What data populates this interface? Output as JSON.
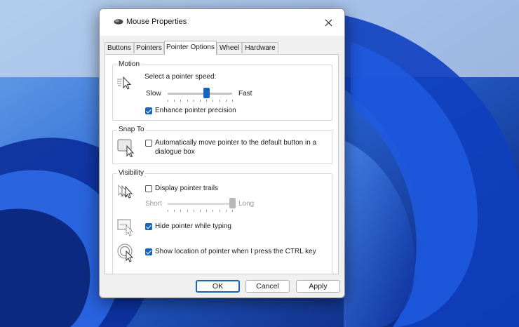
{
  "window": {
    "title": "Mouse Properties"
  },
  "tabs": [
    {
      "label": "Buttons"
    },
    {
      "label": "Pointers"
    },
    {
      "label": "Pointer Options"
    },
    {
      "label": "Wheel"
    },
    {
      "label": "Hardware"
    }
  ],
  "active_tab": "Pointer Options",
  "motion": {
    "group_label": "Motion",
    "speed_label": "Select a pointer speed:",
    "slow_label": "Slow",
    "fast_label": "Fast",
    "speed_value": 0.6,
    "enhance_label": "Enhance pointer precision",
    "enhance_checked": true
  },
  "snap": {
    "group_label": "Snap To",
    "auto_label_line1": "Automatically move pointer to the default button in a",
    "auto_label_line2": "dialogue box",
    "auto_checked": false
  },
  "visibility": {
    "group_label": "Visibility",
    "trails_label": "Display pointer trails",
    "trails_checked": false,
    "short_label": "Short",
    "long_label": "Long",
    "trails_value": 1.0,
    "hide_label": "Hide pointer while typing",
    "hide_checked": true,
    "ctrl_label": "Show location of pointer when I press the CTRL key",
    "ctrl_checked": true
  },
  "buttons": {
    "ok": "OK",
    "cancel": "Cancel",
    "apply": "Apply"
  },
  "colors": {
    "accent": "#1565c0",
    "wallpaper": "#0a2a8a"
  },
  "icons": {
    "title": "mouse-icon",
    "close": "close-icon",
    "motion": "pointer-motion-icon",
    "snap": "pointer-snap-icon",
    "trails": "pointer-trails-icon",
    "hide": "pointer-hide-icon",
    "ctrl": "pointer-locate-icon"
  }
}
